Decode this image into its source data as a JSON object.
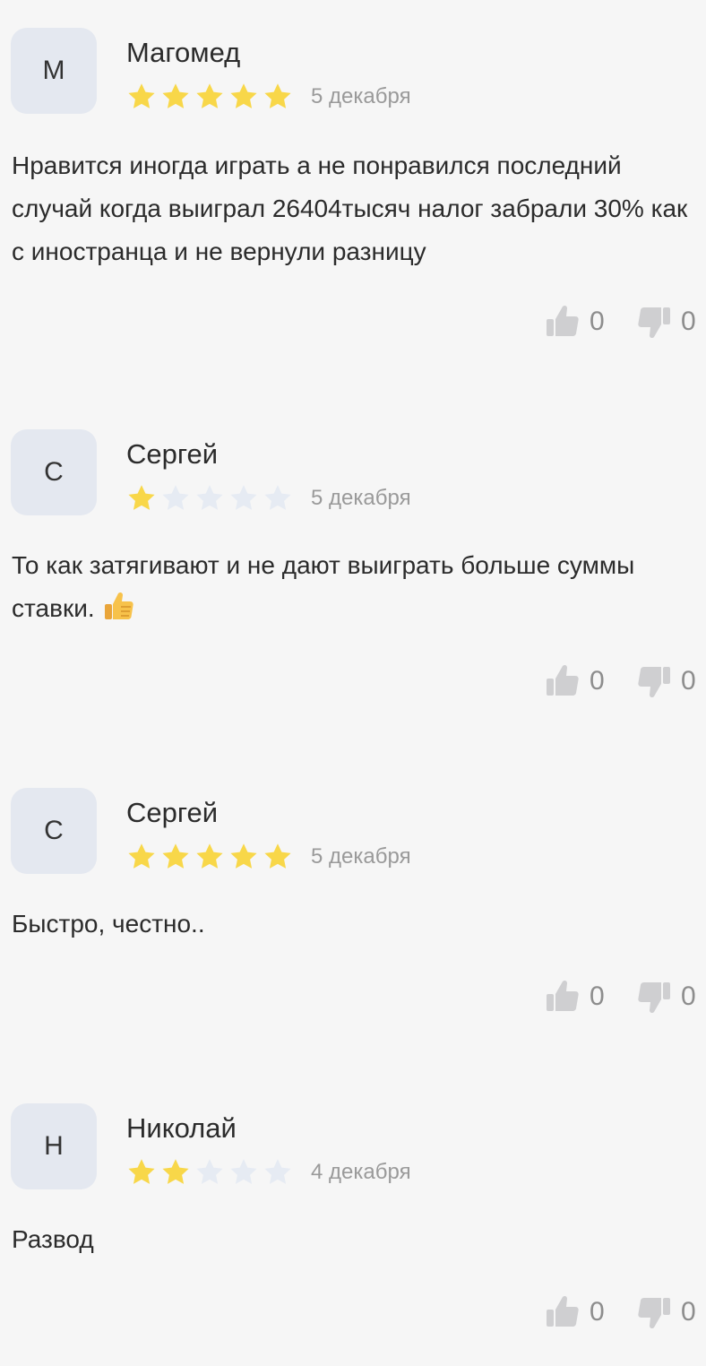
{
  "colors": {
    "background": "#f6f6f6",
    "avatar_bg": "#e4e8f0",
    "star_filled": "#f8d749",
    "star_empty": "#e6ebf3",
    "muted_text": "#9a9a9a",
    "vote_icon": "#cfcfd1"
  },
  "icons": {
    "star": "star-icon",
    "like": "thumbs-up-icon",
    "dislike": "thumbs-down-icon",
    "emoji": "thumbs-up-emoji"
  },
  "reviews": [
    {
      "initial": "М",
      "name": "Магомед",
      "rating": 5,
      "max_rating": 5,
      "date": "5 декабря",
      "text": "Нравится иногда играть а не понравился последний случай когда выиграл 26404тысяч налог забрали 30% как с иностранца и не вернули разницу",
      "emoji": null,
      "likes": "0",
      "dislikes": "0"
    },
    {
      "initial": "С",
      "name": "Сергей",
      "rating": 1,
      "max_rating": 5,
      "date": "5 декабря",
      "text": "То как затягивают и не дают выиграть больше суммы ставки.",
      "emoji": "thumbs-up",
      "likes": "0",
      "dislikes": "0"
    },
    {
      "initial": "С",
      "name": "Сергей",
      "rating": 5,
      "max_rating": 5,
      "date": "5 декабря",
      "text": "Быстро, честно..",
      "emoji": null,
      "likes": "0",
      "dislikes": "0"
    },
    {
      "initial": "Н",
      "name": "Николай",
      "rating": 2,
      "max_rating": 5,
      "date": "4 декабря",
      "text": "Развод",
      "emoji": null,
      "likes": "0",
      "dislikes": "0"
    }
  ]
}
